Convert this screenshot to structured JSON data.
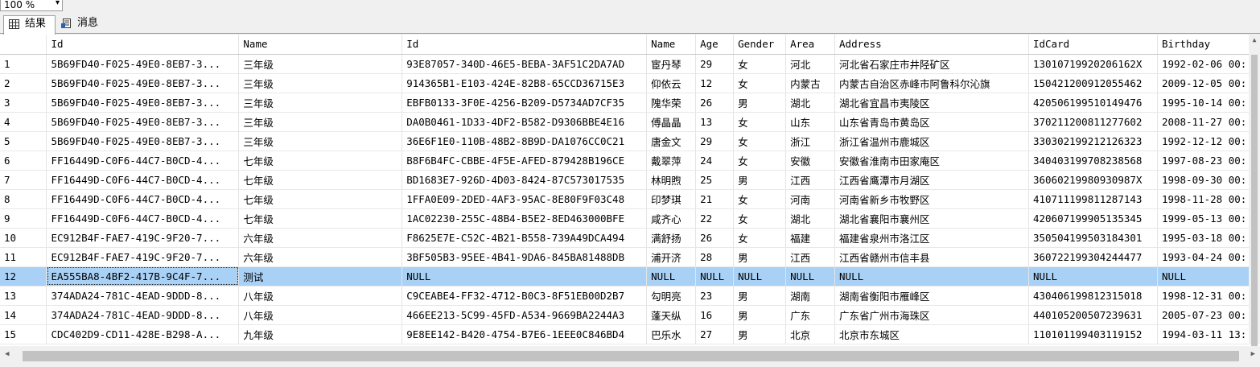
{
  "toolbar": {
    "zoom": "100 %"
  },
  "tabs": [
    {
      "label": "结果",
      "icon": "grid-icon"
    },
    {
      "label": "消息",
      "icon": "message-icon"
    }
  ],
  "grid": {
    "columns": [
      "Id",
      "Name",
      "Id",
      "Name",
      "Age",
      "Gender",
      "Area",
      "Address",
      "IdCard",
      "Birthday"
    ],
    "selected_row": 11,
    "rows": [
      [
        "1",
        "5B69FD40-F025-49E0-8EB7-3...",
        "三年级",
        "93E87057-340D-46E5-BEBA-3AF51C2DA7AD",
        "宦丹琴",
        "29",
        "女",
        "河北",
        "河北省石家庄市井陉矿区",
        "130107199202061​62X",
        "1992-02-06 00:"
      ],
      [
        "2",
        "5B69FD40-F025-49E0-8EB7-3...",
        "三年级",
        "914365B1-E103-424E-82B8-65CCD36715E3",
        "仰依云",
        "12",
        "女",
        "内蒙古",
        "内蒙古自治区赤峰市阿鲁科尔沁旗",
        "150421200912055462",
        "2009-12-05 00:"
      ],
      [
        "3",
        "5B69FD40-F025-49E0-8EB7-3...",
        "三年级",
        "EBFB0133-3F0E-4256-B209-D5734AD7CF35",
        "隗华荣",
        "26",
        "男",
        "湖北",
        "湖北省宜昌市夷陵区",
        "420506199510149476",
        "1995-10-14 00:"
      ],
      [
        "4",
        "5B69FD40-F025-49E0-8EB7-3...",
        "三年级",
        "DA0B0461-1D33-4DF2-B582-D9306BBE4E16",
        "傅晶晶",
        "13",
        "女",
        "山东",
        "山东省青岛市黄岛区",
        "370211200811277602",
        "2008-11-27 00:"
      ],
      [
        "5",
        "5B69FD40-F025-49E0-8EB7-3...",
        "三年级",
        "36E6F1E0-110B-48B2-8B9D-DA1076CC0C21",
        "唐金文",
        "29",
        "女",
        "浙江",
        "浙江省温州市鹿城区",
        "330302199212126323",
        "1992-12-12 00:"
      ],
      [
        "6",
        "FF16449D-C0F6-44C7-B0CD-4...",
        "七年级",
        "B8F6B4FC-CBBE-4F5E-AFED-879428B196CE",
        "戴翠萍",
        "24",
        "女",
        "安徽",
        "安徽省淮南市田家庵区",
        "340403199708238568",
        "1997-08-23 00:"
      ],
      [
        "7",
        "FF16449D-C0F6-44C7-B0CD-4...",
        "七年级",
        "BD1683E7-926D-4D03-8424-87C573017535",
        "林明煦",
        "25",
        "男",
        "江西",
        "江西省鹰潭市月湖区",
        "36060219980930987X",
        "1998-09-30 00:"
      ],
      [
        "8",
        "FF16449D-C0F6-44C7-B0CD-4...",
        "七年级",
        "1FFA0E09-2DED-4AF3-95AC-8E80F9F03C48",
        "印梦琪",
        "21",
        "女",
        "河南",
        "河南省新乡市牧野区",
        "410711199811287143",
        "1998-11-28 00:"
      ],
      [
        "9",
        "FF16449D-C0F6-44C7-B0CD-4...",
        "七年级",
        "1AC02230-255C-48B4-B5E2-8ED463000BFE",
        "咸齐心",
        "22",
        "女",
        "湖北",
        "湖北省襄阳市襄州区",
        "420607199905135345",
        "1999-05-13 00:"
      ],
      [
        "10",
        "EC912B4F-FAE7-419C-9F20-7...",
        "六年级",
        "F8625E7E-C52C-4B21-B558-739A49DCA494",
        "满舒扬",
        "26",
        "女",
        "福建",
        "福建省泉州市洛江区",
        "350504199503184301",
        "1995-03-18 00:"
      ],
      [
        "11",
        "EC912B4F-FAE7-419C-9F20-7...",
        "六年级",
        "3BF505B3-95EE-4B41-9DA6-845BA81488DB",
        "浦开济",
        "28",
        "男",
        "江西",
        "江西省赣州市信丰县",
        "360722199304244477",
        "1993-04-24 00:"
      ],
      [
        "12",
        "EA555BA8-4BF2-417B-9C4F-7...",
        "测试",
        "NULL",
        "NULL",
        "NULL",
        "NULL",
        "NULL",
        "NULL",
        "NULL",
        "NULL"
      ],
      [
        "13",
        "374ADA24-781C-4EAD-9DDD-8...",
        "八年级",
        "C9CEABE4-FF32-4712-B0C3-8F51EB00D2B7",
        "勾明亮",
        "23",
        "男",
        "湖南",
        "湖南省衡阳市雁峰区",
        "430406199812315018",
        "1998-12-31 00:"
      ],
      [
        "14",
        "374ADA24-781C-4EAD-9DDD-8...",
        "八年级",
        "466EE213-5C99-45FD-A534-9669BA2244A3",
        "蓬天纵",
        "16",
        "男",
        "广东",
        "广东省广州市海珠区",
        "440105200507239631",
        "2005-07-23 00:"
      ],
      [
        "15",
        "CDC402D9-CD11-428E-B298-A...",
        "九年级",
        "9E8EE142-B420-4754-B7E6-1EEE0C846BD4",
        "巴乐水",
        "27",
        "男",
        "北京",
        "北京市东城区",
        "110101199403119152",
        "1994-03-11 13:"
      ]
    ]
  }
}
